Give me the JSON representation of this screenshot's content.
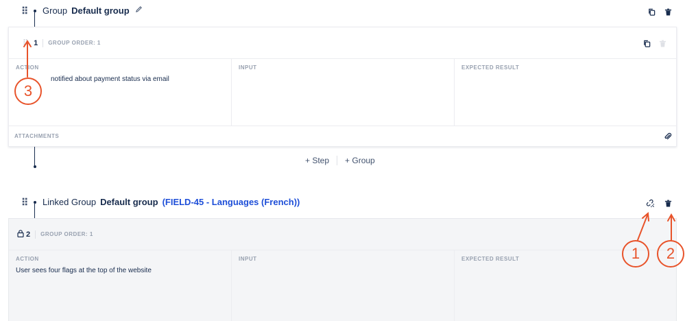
{
  "group1": {
    "kind": "Group",
    "name": "Default group",
    "step": {
      "number": "1",
      "order": "GROUP ORDER: 1",
      "columns": [
        "ACTION",
        "INPUT",
        "EXPECTED RESULT"
      ],
      "action_text": "notified about payment status via email",
      "attachments": "ATTACHMENTS"
    },
    "add_step": "+  Step",
    "add_group": "+  Group"
  },
  "group2": {
    "kind": "Linked Group",
    "name": "Default group",
    "linked_issue": "(FIELD-45 - Languages (French))",
    "step": {
      "number": "2",
      "order": "GROUP ORDER: 1",
      "columns": [
        "ACTION",
        "INPUT",
        "EXPECTED RESULT"
      ],
      "action_text": "User sees four flags at the top of the website"
    }
  },
  "annotations": [
    "3",
    "1",
    "2"
  ],
  "colors": {
    "link_blue": "#1d4ed8",
    "annotation": "#e8532a",
    "muted": "#97a0af"
  },
  "icons": [
    "drag-handle-icon",
    "pencil-icon",
    "copy-icon",
    "trash-icon",
    "paperclip-icon",
    "unlink-icon",
    "lock-icon"
  ]
}
